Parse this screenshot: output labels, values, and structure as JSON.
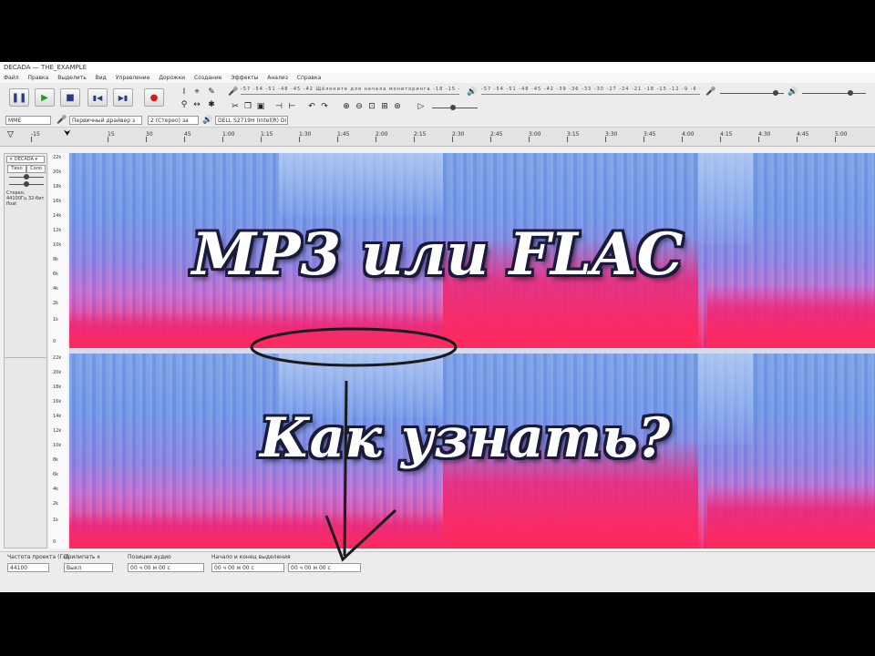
{
  "window": {
    "title": "DECADA — THE_EXAMPLE"
  },
  "menu": [
    "Файл",
    "Правка",
    "Выделить",
    "Вид",
    "Управление",
    "Дорожки",
    "Создание",
    "Эффекты",
    "Анализ",
    "Справка"
  ],
  "transport": {
    "pause_icon": "pause-icon",
    "play_icon": "play-icon",
    "stop_icon": "stop-icon",
    "skip_start_icon": "skip-start-icon",
    "skip_end_icon": "skip-end-icon",
    "record_icon": "record-icon",
    "record_color": "#d21b1b",
    "play_color": "#1aa31a"
  },
  "meters": {
    "record_scale": "-57 -54 -51 -48 -45 -42 Щёлкните для начала мониторинга -18 -15 -12 -9 -6 -3 0",
    "play_scale": "-57 -54 -51 -48 -45 -42 -39 -36 -33 -30 -27 -24 -21 -18 -15 -12 -9 -6 -3 0"
  },
  "device_toolbar": {
    "host": "MME",
    "input": "Первичный драйвер з",
    "channels": "2 (Стерео) за",
    "output": "DELL S2719H (Intel(R) Di"
  },
  "ruler": {
    "ticks": [
      "-15",
      "15",
      "30",
      "45",
      "1:00",
      "1:15",
      "1:30",
      "1:45",
      "2:00",
      "2:15",
      "2:30",
      "2:45",
      "3:00",
      "3:15",
      "3:30",
      "3:45",
      "4:00",
      "4:15",
      "4:30",
      "4:45",
      "5:00"
    ]
  },
  "track": {
    "name": "DECADA",
    "mute": "Тихо",
    "solo": "Соло",
    "info": "Стерео, 44100Гц 32-бит float",
    "scale_top": [
      "22k",
      "20k",
      "18k",
      "16k",
      "14k",
      "12k",
      "10k",
      "8k",
      "6k",
      "4k",
      "2k",
      "1k",
      "0"
    ],
    "scale_bottom": [
      "22k",
      "20k",
      "18k",
      "16k",
      "14k",
      "12k",
      "10k",
      "8k",
      "6k",
      "4k",
      "2k",
      "1k",
      "0"
    ]
  },
  "spectrogram_colors": {
    "low": "#7aa0e6",
    "mid": "#8a82e0",
    "high": "#ff2060"
  },
  "statusbar": {
    "rate_label": "Частота проекта (Гц)",
    "rate_value": "44100",
    "snap_label": "Прилипать к",
    "snap_value": "Выкл",
    "sel_label": "Позиция аудио",
    "sel_value": "00 ч 00 м 00 с",
    "range_label": "Начало и конец выделения",
    "range_start": "00 ч 00 м 00 с",
    "range_end": "00 ч 00 м 00 с"
  },
  "overlay": {
    "title": "MP3 или FLAC",
    "subtitle": "Как узнать?"
  }
}
